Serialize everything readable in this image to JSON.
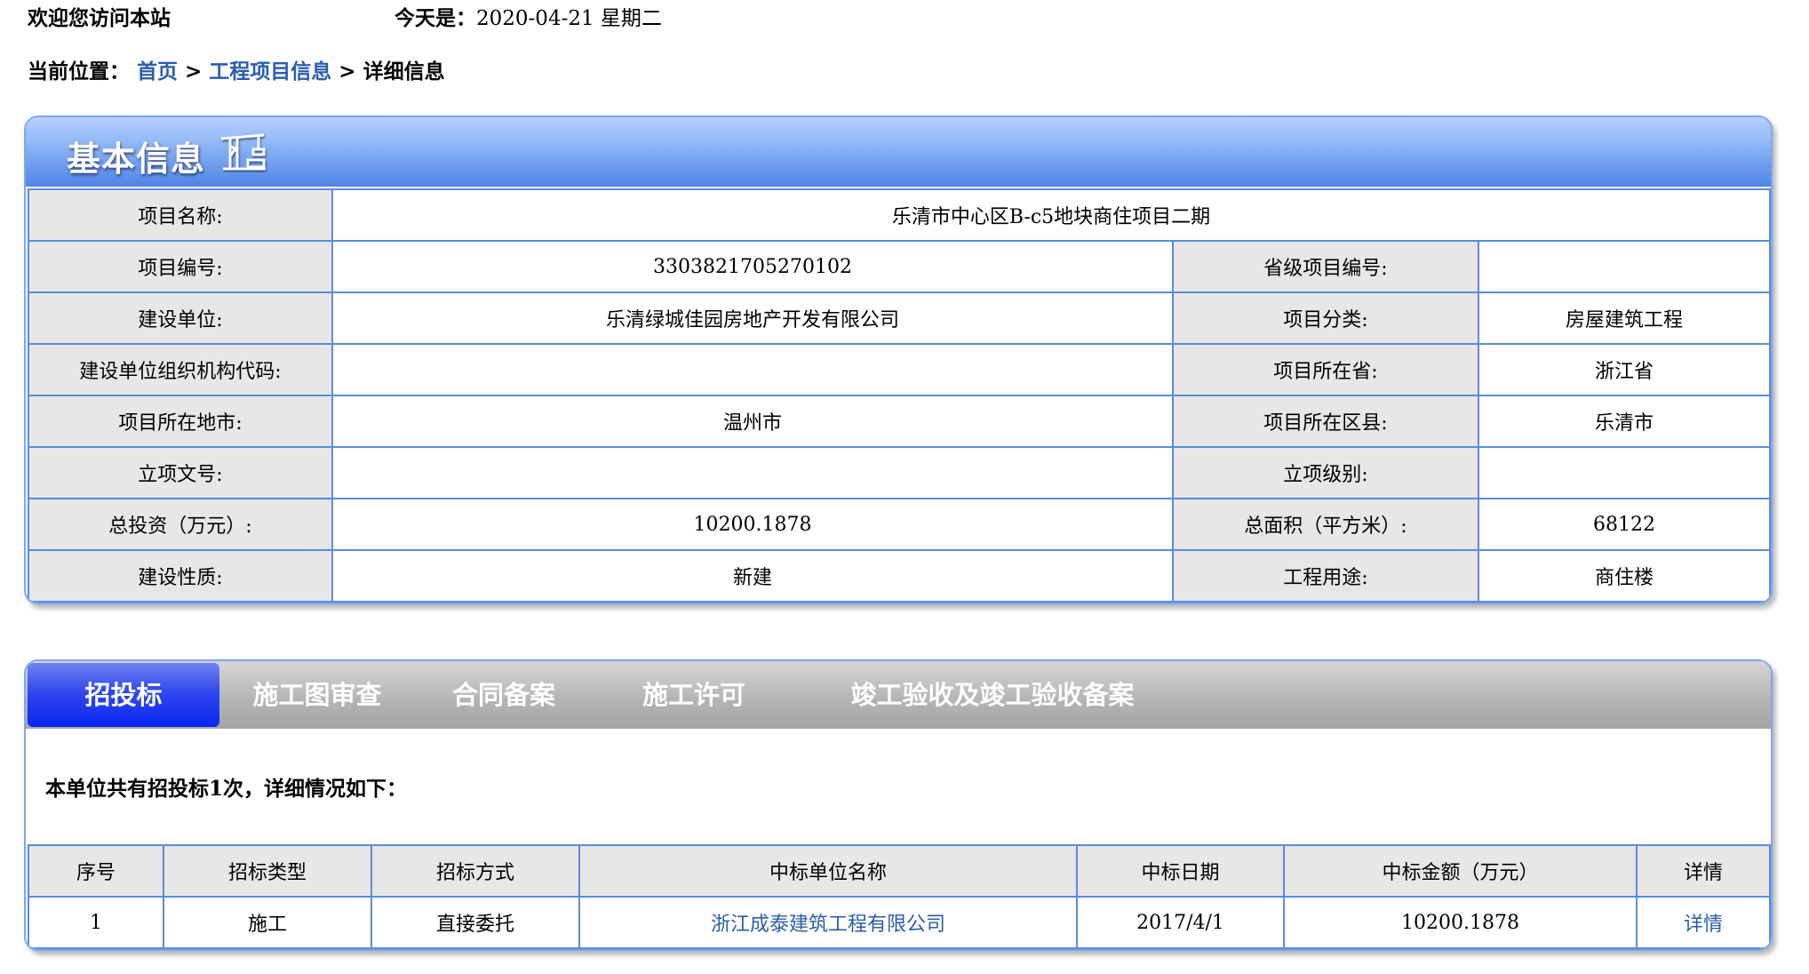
{
  "header": {
    "welcome": "欢迎您访问本站",
    "date_prefix": "今天是：",
    "date": "2020-04-21 星期二"
  },
  "breadcrumb": {
    "label": "当前位置：",
    "items": [
      "首页",
      "工程项目信息",
      "详细信息"
    ],
    "separator": ">"
  },
  "basic_info": {
    "title": "基本信息",
    "icon": "crane-icon",
    "rows": [
      [
        {
          "label": "项目名称:",
          "value": "乐清市中心区B-c5地块商住项目二期"
        }
      ],
      [
        {
          "label": "项目编号:",
          "value": "3303821705270102"
        },
        {
          "label": "省级项目编号:",
          "value": ""
        }
      ],
      [
        {
          "label": "建设单位:",
          "value": "乐清绿城佳园房地产开发有限公司"
        },
        {
          "label": "项目分类:",
          "value": "房屋建筑工程"
        }
      ],
      [
        {
          "label": "建设单位组织机构代码:",
          "value": ""
        },
        {
          "label": "项目所在省:",
          "value": "浙江省"
        }
      ],
      [
        {
          "label": "项目所在地市:",
          "value": "温州市"
        },
        {
          "label": "项目所在区县:",
          "value": "乐清市"
        }
      ],
      [
        {
          "label": "立项文号:",
          "value": ""
        },
        {
          "label": "立项级别:",
          "value": ""
        }
      ],
      [
        {
          "label": "总投资（万元）:",
          "value": "10200.1878"
        },
        {
          "label": "总面积（平方米）:",
          "value": "68122"
        }
      ],
      [
        {
          "label": "建设性质:",
          "value": "新建"
        },
        {
          "label": "工程用途:",
          "value": "商住楼"
        }
      ]
    ]
  },
  "tabs": {
    "items": [
      "招投标",
      "施工图审查",
      "合同备案",
      "施工许可",
      "竣工验收及竣工验收备案"
    ],
    "active": 0
  },
  "bidding": {
    "summary": "本单位共有招投标1次，详细情况如下：",
    "columns": [
      "序号",
      "招标类型",
      "招标方式",
      "中标单位名称",
      "中标日期",
      "中标金额（万元）",
      "详情"
    ],
    "rows": [
      [
        "1",
        "施工",
        "直接委托",
        "浙江成泰建筑工程有限公司",
        "2017/4/1",
        "10200.1878",
        "详情"
      ]
    ]
  },
  "colors": {
    "link": "#2a5db0",
    "border": "#5b8be0",
    "label_bg": "#e7e7e7",
    "active_tab": "#1f3af0"
  }
}
